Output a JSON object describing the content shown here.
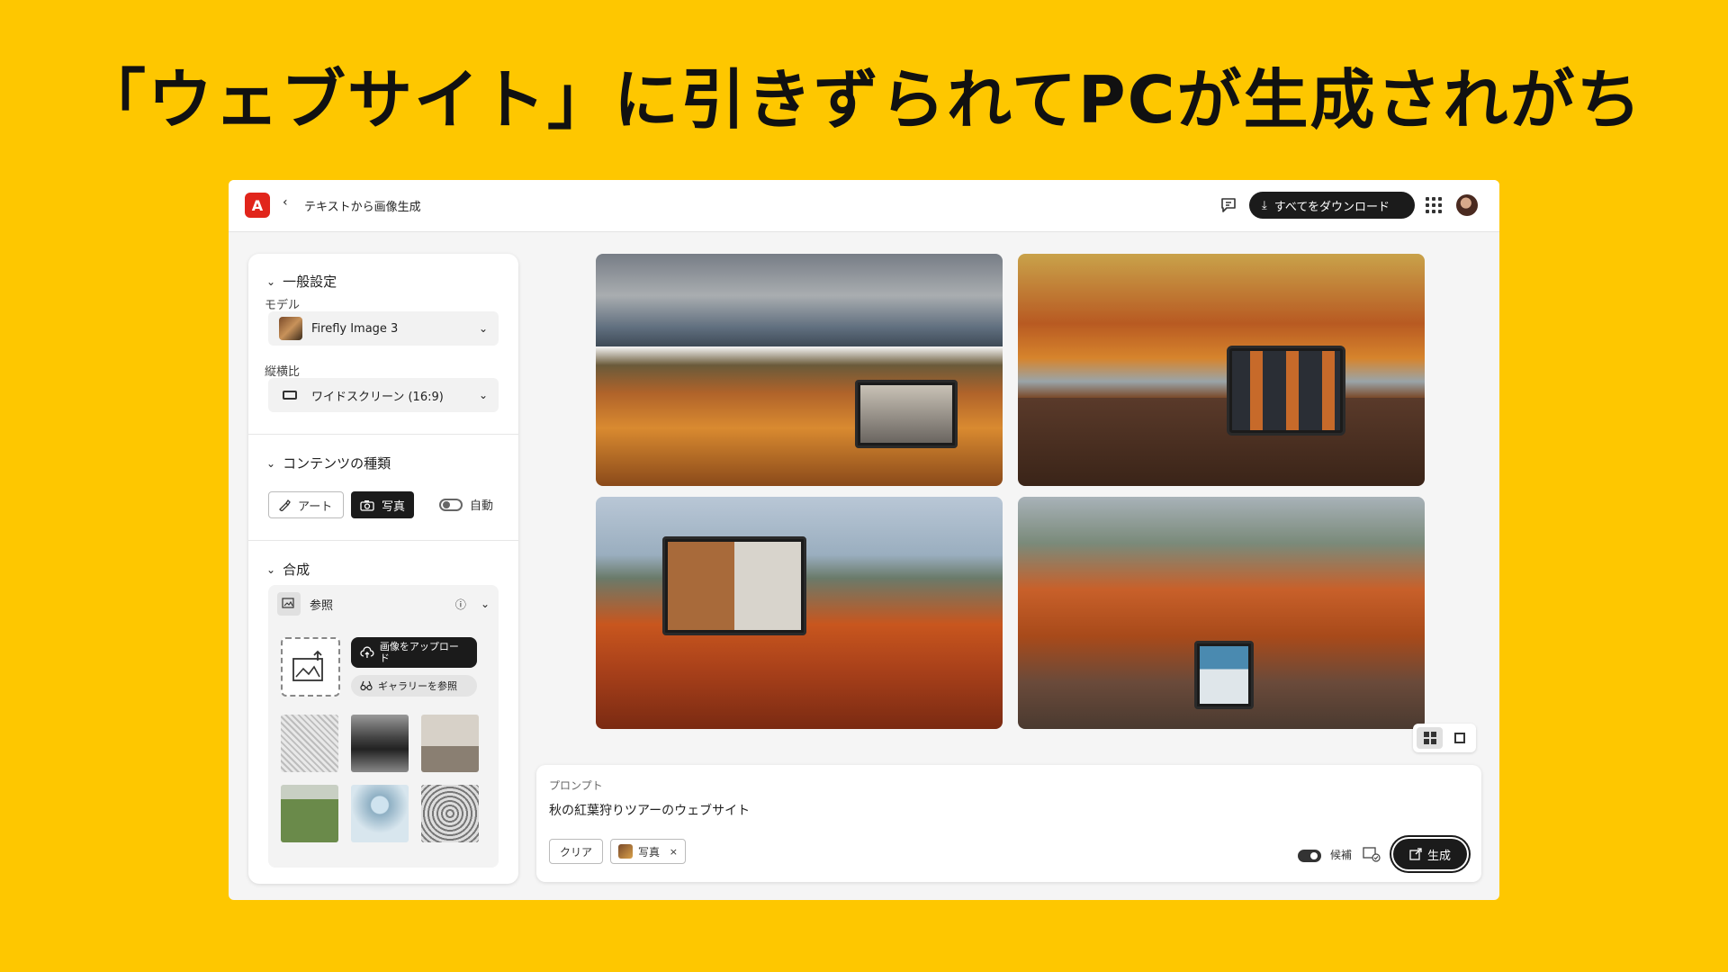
{
  "headline": "「ウェブサイト」に引きずられてPCが生成されがち",
  "app": {
    "logo_glyph": "A",
    "back_glyph": "‹",
    "page_title": "テキストから画像生成",
    "download_all": "すべてをダウンロード",
    "accent_color": "#FEC700",
    "logo_color": "#e1251b"
  },
  "panel": {
    "general": {
      "title": "一般設定",
      "model_label": "モデル",
      "model_value": "Firefly Image 3",
      "ratio_label": "縦横比",
      "ratio_value": "ワイドスクリーン (16:9)"
    },
    "content": {
      "title": "コンテンツの種類",
      "art": "アート",
      "photo": "写真",
      "auto": "自動"
    },
    "composition": {
      "title": "合成",
      "reference": "参照",
      "upload": "画像をアップロード",
      "gallery": "ギャラリーを参照"
    }
  },
  "prompt": {
    "label": "プロンプト",
    "text": "秋の紅葉狩りツアーのウェブサイト",
    "clear": "クリア",
    "tag": "写真",
    "tag_remove": "×",
    "candidates": "候補",
    "generate": "生成"
  },
  "icons": {
    "chevron": "⌄",
    "caret": "⌄",
    "info": "ⓘ",
    "download": "⤓"
  }
}
